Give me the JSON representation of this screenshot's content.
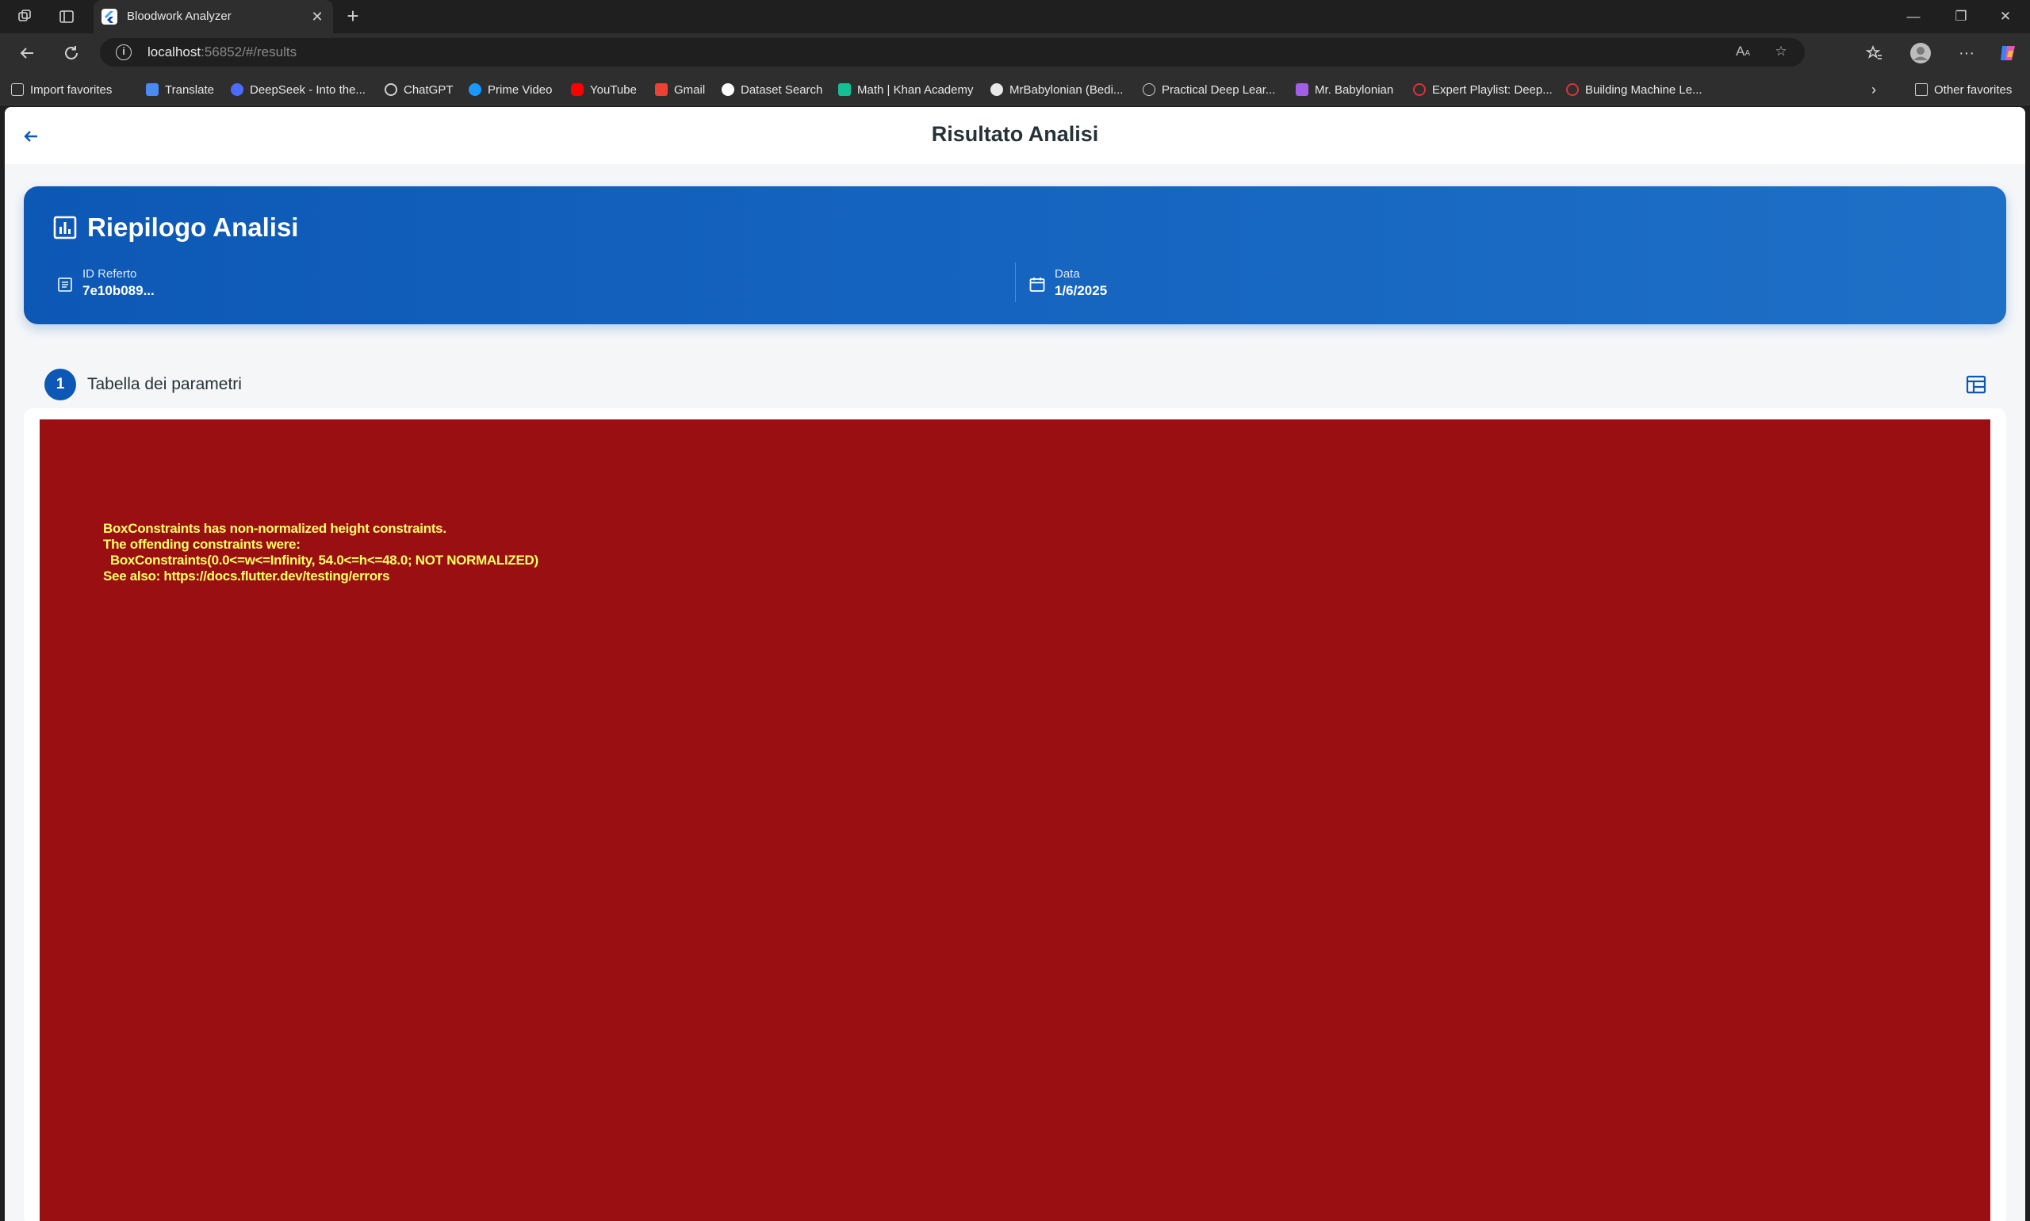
{
  "browser": {
    "tab_title": "Bloodwork Analyzer",
    "url_host": "localhost",
    "url_rest": ":56852/#/results",
    "bookmarks": [
      {
        "label": "Import favorites",
        "color": "#cfcfcf"
      },
      {
        "label": "Translate",
        "color": "#4a8af4"
      },
      {
        "label": "DeepSeek - Into the...",
        "color": "#4d6bfe"
      },
      {
        "label": "ChatGPT",
        "color": "#d0d0d0"
      },
      {
        "label": "Prime Video",
        "color": "#1a98ff"
      },
      {
        "label": "YouTube",
        "color": "#ff0000"
      },
      {
        "label": "Gmail",
        "color": "#ea4335"
      },
      {
        "label": "Dataset Search",
        "color": "#ffffff"
      },
      {
        "label": "Math | Khan Academy",
        "color": "#14bf96"
      },
      {
        "label": "MrBabylonian (Bedi...",
        "color": "#e8e8e8"
      },
      {
        "label": "Practical Deep Lear...",
        "color": "#cfcfcf"
      },
      {
        "label": "Mr. Babylonian",
        "color": "#a35ee8"
      },
      {
        "label": "Expert Playlist: Deep...",
        "color": "#e0303a"
      },
      {
        "label": "Building Machine Le...",
        "color": "#e0303a"
      }
    ],
    "other_favorites": "Other favorites"
  },
  "app": {
    "title": "Risultato Analisi",
    "summary": {
      "title": "Riepilogo Analisi",
      "id_label": "ID Referto",
      "id_value": "7e10b089...",
      "date_label": "Data",
      "date_value": "1/6/2025"
    },
    "section": {
      "step": "1",
      "title": "Tabella dei parametri"
    },
    "error_message": "BoxConstraints has non-normalized height constraints.\nThe offending constraints were:\n  BoxConstraints(0.0<=w<=Infinity, 54.0<=h<=48.0; NOT NORMALIZED)\nSee also: https://docs.flutter.dev/testing/errors"
  },
  "colors": {
    "primary": "#0d58b5",
    "error_bg": "#9a0f12",
    "error_text": "#ffff66"
  }
}
